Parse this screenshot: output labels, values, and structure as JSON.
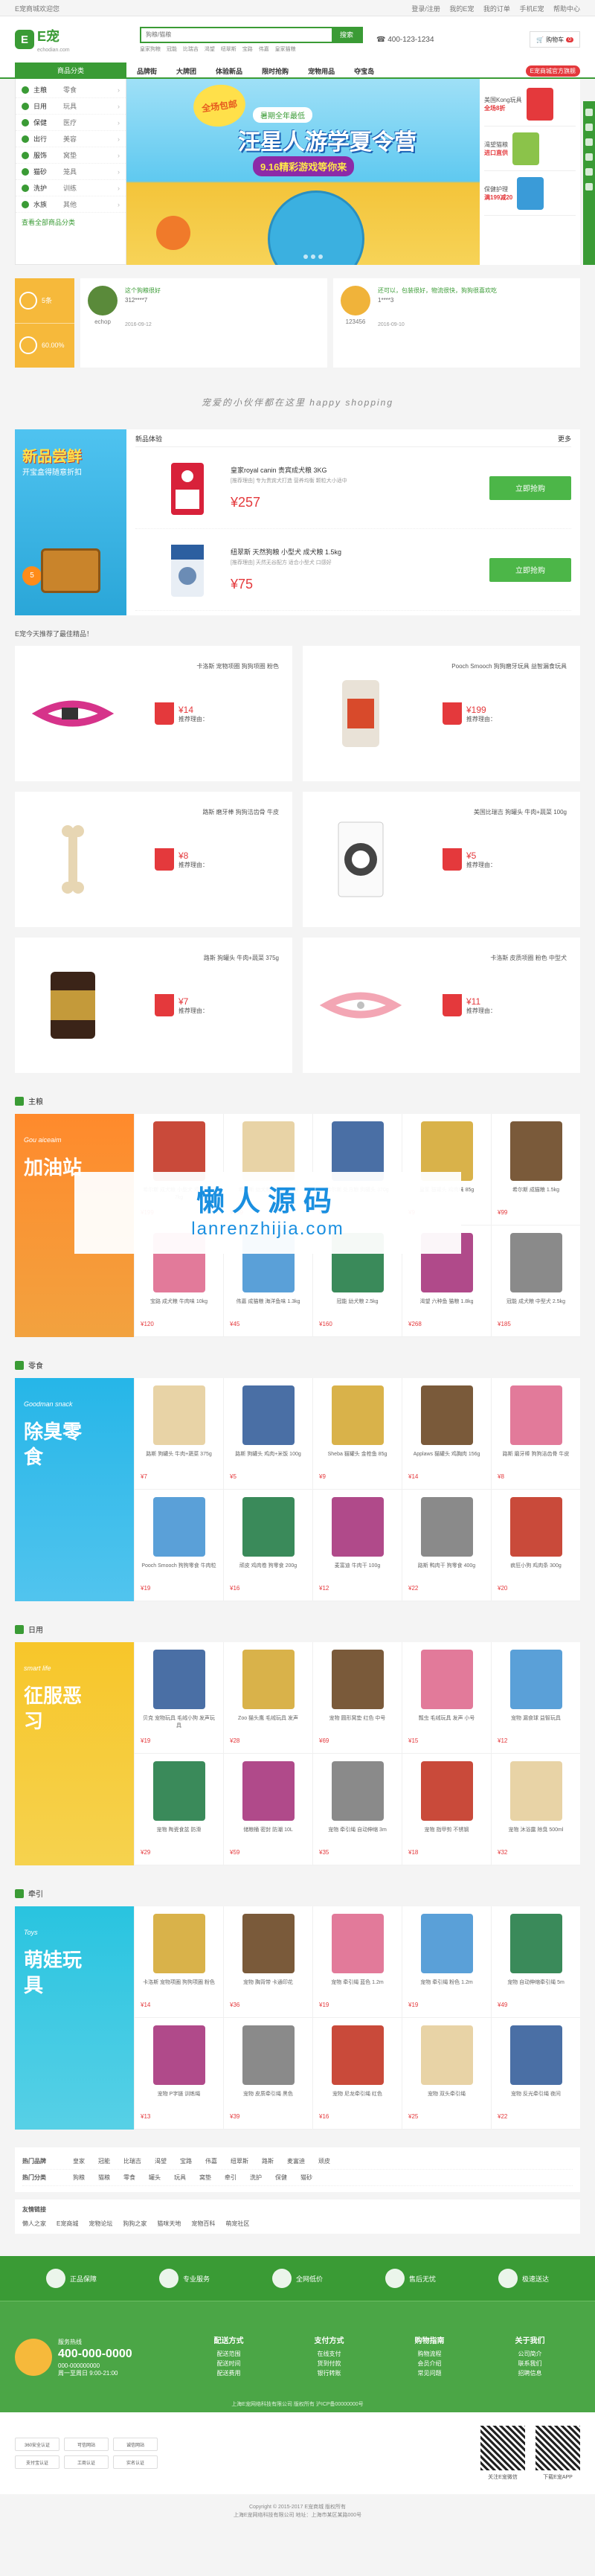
{
  "topbar": {
    "welcome": "E宠商城欢迎您",
    "links": [
      "登录/注册",
      "我的E宠",
      "我的订单",
      "手机E宠",
      "帮助中心"
    ]
  },
  "header": {
    "logo_text": "E宠",
    "logo_sub": "echodian.com",
    "search_placeholder": "狗粮/猫粮",
    "search_button": "搜索",
    "hot_words": [
      "皇家狗粮",
      "冠能",
      "比瑞吉",
      "渴望",
      "纽翠斯",
      "宝路",
      "伟嘉",
      "皇家猫粮"
    ],
    "phone": "400-123-1234",
    "cart_label": "购物车",
    "cart_count": "0"
  },
  "nav": {
    "category_label": "商品分类",
    "items": [
      "品牌街",
      "大牌团",
      "体验新品",
      "限时抢购",
      "宠物用品",
      "夺宝岛"
    ],
    "badge": "E宠商城官方旗舰"
  },
  "sidebar": [
    {
      "a": "主粮",
      "b": "零食"
    },
    {
      "a": "日用",
      "b": "玩具"
    },
    {
      "a": "保健",
      "b": "医疗"
    },
    {
      "a": "出行",
      "b": "美容"
    },
    {
      "a": "服饰",
      "b": "窝垫"
    },
    {
      "a": "猫砂",
      "b": "笼具"
    },
    {
      "a": "洗护",
      "b": "训练"
    },
    {
      "a": "水族",
      "b": "其他"
    }
  ],
  "sidebar_more": "查看全部商品分类",
  "banner": {
    "badge": "全场包邮",
    "pill": "暑期全年最低",
    "title": "汪星人游学夏令营",
    "sub": "9.16精彩游戏等你来"
  },
  "right_ads": [
    {
      "t": "美国Kong玩具",
      "p": "全场8折"
    },
    {
      "t": "渴望猫粮",
      "p": "进口直供"
    },
    {
      "t": "保健护理",
      "p": "满199减20"
    }
  ],
  "member": {
    "stat1": "5条",
    "stat2": "60.00%",
    "user1_name": "echop",
    "user1_text": "这个狗粮很好",
    "user1_meta": "312****7",
    "user1_date": "2016-09-12",
    "user2_name": "123456",
    "user2_text": "还可以，包装很好，物流很快，狗狗很喜欢吃",
    "user2_meta": "1****3",
    "user2_date": "2016-09-10"
  },
  "slogan": "宠爱的小伙伴都在这里 happy shopping",
  "new_products": {
    "header": "新品体验",
    "more": "更多",
    "banner_title": "新品尝鲜",
    "banner_sub": "开宝盒得随意折扣",
    "items": [
      {
        "name": "皇家royal canin 贵宾成犬粮 3KG",
        "desc": "[推荐理由] 专为贵宾犬打造 营养均衡 颗粒大小适中",
        "price": "¥257",
        "buy": "立即抢购"
      },
      {
        "name": "纽翠斯 天然狗粮 小型犬 成犬粮 1.5kg",
        "desc": "[推荐理由] 天然无谷配方 适合小型犬 口感好",
        "price": "¥75",
        "buy": "立即抢购"
      }
    ]
  },
  "rec_title": "E宠今天推荐了最佳精品！",
  "recommend": [
    {
      "name": "卡洛斯 宠物项圈 狗狗项圈 粉色",
      "price": "¥14",
      "label": "推荐理由："
    },
    {
      "name": "Pooch Smooch 狗狗磨牙玩具 益智漏食玩具",
      "price": "¥199",
      "label": "推荐理由："
    },
    {
      "name": "路斯 磨牙棒 狗狗洁齿骨 牛皮",
      "price": "¥8",
      "label": "推荐理由："
    },
    {
      "name": "美国比瑞吉 狗罐头 牛肉+蔬菜 100g",
      "price": "¥5",
      "label": "推荐理由："
    },
    {
      "name": "路斯 狗罐头 牛肉+蔬菜 375g",
      "price": "¥7",
      "label": "推荐理由："
    },
    {
      "name": "卡洛斯 皮质项圈 粉色 中型犬",
      "price": "¥11",
      "label": "推荐理由："
    }
  ],
  "floors": [
    {
      "name": "主粮",
      "tag": "Gou aiceaim",
      "big": "加油站",
      "color1": "#ff8a2c",
      "color2": "#f2a23f",
      "items": [
        {
          "n": "希尔斯 成犬粮 小型犬 鸡肉配方 7kg",
          "p": "¥199"
        },
        {
          "n": "希尔斯 幼犬粮 大型犬 2kg",
          "p": "¥159"
        },
        {
          "n": "希尔斯 处方粮 狗罐头 370g",
          "p": "¥23"
        },
        {
          "n": "皇家 猫罐头 鸡肉味 85g",
          "p": "¥9"
        },
        {
          "n": "希尔斯 成猫粮 1.5kg",
          "p": "¥99"
        },
        {
          "n": "宝路 成犬粮 牛肉味 10kg",
          "p": "¥120"
        },
        {
          "n": "伟嘉 成猫粮 海洋鱼味 1.3kg",
          "p": "¥45"
        },
        {
          "n": "冠能 幼犬粮 2.5kg",
          "p": "¥160"
        },
        {
          "n": "渴望 六种鱼 猫粮 1.8kg",
          "p": "¥268"
        },
        {
          "n": "冠能 成犬粮 中型犬 2.5kg",
          "p": "¥185"
        }
      ]
    },
    {
      "name": "零食",
      "tag": "Goodman snack",
      "big": "除臭零食",
      "color1": "#26b6e8",
      "color2": "#51c4ee",
      "items": [
        {
          "n": "路斯 狗罐头 牛肉+蔬菜 375g",
          "p": "¥7"
        },
        {
          "n": "路斯 狗罐头 鸡肉+米饭 100g",
          "p": "¥5"
        },
        {
          "n": "Sheba 猫罐头 金枪鱼 85g",
          "p": "¥9"
        },
        {
          "n": "Applaws 猫罐头 鸡胸肉 156g",
          "p": "¥14"
        },
        {
          "n": "路斯 磨牙棒 狗狗洁齿骨 牛皮",
          "p": "¥8"
        },
        {
          "n": "Pooch Smooch 狗狗零食 牛肉粒",
          "p": "¥19"
        },
        {
          "n": "顽皮 鸡肉卷 狗零食 200g",
          "p": "¥16"
        },
        {
          "n": "麦富迪 牛肉干 100g",
          "p": "¥12"
        },
        {
          "n": "路斯 鸭肉干 狗零食 400g",
          "p": "¥22"
        },
        {
          "n": "疯狂小狗 鸡肉条 300g",
          "p": "¥20"
        }
      ]
    },
    {
      "name": "日用",
      "tag": "smart life",
      "big": "征服恶习",
      "color1": "#f7c62a",
      "color2": "#f6d24e",
      "items": [
        {
          "n": "贝克 宠物玩具 毛绒小狗 发声玩具",
          "p": "¥19"
        },
        {
          "n": "Zoo 猫头鹰 毛绒玩具 发声",
          "p": "¥28"
        },
        {
          "n": "宠物 圆形窝垫 红色 中号",
          "p": "¥69"
        },
        {
          "n": "瓢虫 毛绒玩具 发声 小号",
          "p": "¥15"
        },
        {
          "n": "宠物 漏食球 益智玩具",
          "p": "¥12"
        },
        {
          "n": "宠物 陶瓷食盆 防滑",
          "p": "¥29"
        },
        {
          "n": "储粮桶 密封 防潮 10L",
          "p": "¥59"
        },
        {
          "n": "宠物 牵引绳 自动伸缩 3m",
          "p": "¥35"
        },
        {
          "n": "宠物 指甲剪 不锈钢",
          "p": "¥18"
        },
        {
          "n": "宠物 沐浴露 除臭 500ml",
          "p": "¥32"
        }
      ]
    },
    {
      "name": "牵引",
      "tag": "Toys",
      "big": "萌娃玩具",
      "color1": "#29c4e0",
      "color2": "#57d0e6",
      "items": [
        {
          "n": "卡洛斯 宠物项圈 狗狗项圈 粉色",
          "p": "¥14"
        },
        {
          "n": "宠物 胸背带 卡通印花",
          "p": "¥36"
        },
        {
          "n": "宠物 牵引绳 蓝色 1.2m",
          "p": "¥19"
        },
        {
          "n": "宠物 牵引绳 粉色 1.2m",
          "p": "¥19"
        },
        {
          "n": "宠物 自动伸缩牵引绳 5m",
          "p": "¥49"
        },
        {
          "n": "宠物 P字链 训练绳",
          "p": "¥13"
        },
        {
          "n": "宠物 皮质牵引绳 黑色",
          "p": "¥39"
        },
        {
          "n": "宠物 尼龙牵引绳 红色",
          "p": "¥16"
        },
        {
          "n": "宠物 双头牵引绳",
          "p": "¥25"
        },
        {
          "n": "宠物 反光牵引绳 夜间",
          "p": "¥22"
        }
      ]
    }
  ],
  "watermark": {
    "title": "懒人源码",
    "url": "lanrenzhijia.com"
  },
  "links": {
    "rows": [
      {
        "label": "热门品牌",
        "items": [
          "皇家",
          "冠能",
          "比瑞吉",
          "渴望",
          "宝路",
          "伟嘉",
          "纽翠斯",
          "路斯",
          "麦富迪",
          "顽皮"
        ]
      },
      {
        "label": "热门分类",
        "items": [
          "狗粮",
          "猫粮",
          "零食",
          "罐头",
          "玩具",
          "窝垫",
          "牵引",
          "洗护",
          "保健",
          "猫砂"
        ]
      }
    ],
    "friend_title": "友情链接",
    "friends": [
      "懒人之家",
      "E宠商城",
      "宠物论坛",
      "狗狗之家",
      "猫咪天地",
      "宠物百科",
      "萌宠社区"
    ]
  },
  "services": [
    "正品保障",
    "专业服务",
    "全网低价",
    "售后无忧",
    "极速送达"
  ],
  "footer": {
    "hotline_label": "服务热线",
    "hotline": "400-000-0000",
    "hotline2": "000-000000000",
    "hours": "周一至周日 9:00-21:00",
    "cols": [
      {
        "t": "配送方式",
        "i": [
          "配送范围",
          "配送时间",
          "配送费用"
        ]
      },
      {
        "t": "支付方式",
        "i": [
          "在线支付",
          "货到付款",
          "银行转账"
        ]
      },
      {
        "t": "购物指南",
        "i": [
          "购物流程",
          "会员介绍",
          "常见问题"
        ]
      },
      {
        "t": "关于我们",
        "i": [
          "公司简介",
          "联系我们",
          "招聘信息"
        ]
      }
    ],
    "copy": "上海E宠网络科技有限公司 版权所有 沪ICP备00000000号"
  },
  "certs": [
    "360安全认证",
    "可信网站",
    "诚信网站",
    "支付宝认证",
    "工商认证",
    "实名认证"
  ],
  "qr": [
    "关注E宠微信",
    "下载E宠APP"
  ],
  "bottom": [
    "Copyright © 2015-2017 E宠商城 版权所有",
    "上海E宠网络科技有限公司 地址：上海市某区某路000号"
  ]
}
